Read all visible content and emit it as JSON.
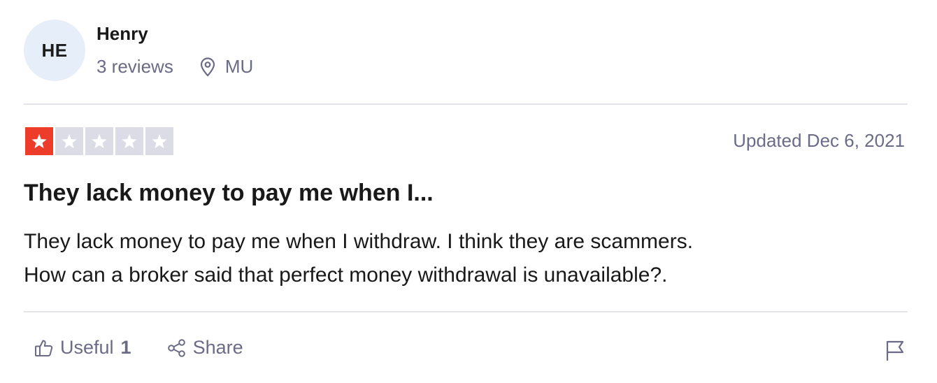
{
  "reviewer": {
    "initials": "HE",
    "name": "Henry",
    "reviews": "3 reviews",
    "location": "MU"
  },
  "rating": {
    "value": 1,
    "max": 5,
    "color": "#ee3c2a"
  },
  "review": {
    "date": "Updated Dec 6, 2021",
    "title": "They lack money to pay me when I...",
    "body_lines": [
      "They lack money to pay me when I withdraw. I think they are scammers.",
      "How can a broker said that perfect money withdrawal is unavailable?."
    ]
  },
  "actions": {
    "useful_label": "Useful",
    "useful_count": "1",
    "share_label": "Share"
  },
  "icons": {
    "location": "map-pin-icon",
    "useful": "thumbs-up-icon",
    "share": "share-icon",
    "report": "flag-icon"
  }
}
